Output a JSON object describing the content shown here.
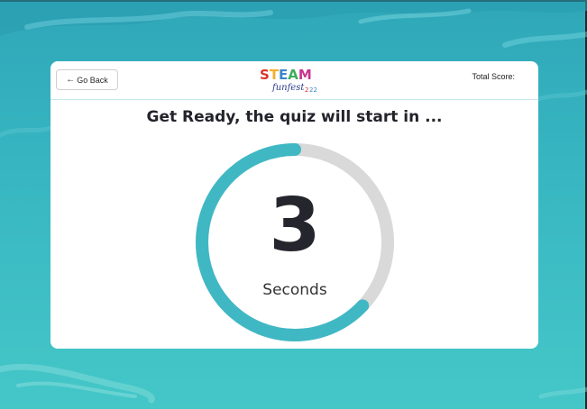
{
  "header": {
    "back_label": "Go Back",
    "back_icon": "arrow-left-icon",
    "logo_text": "STEAM",
    "logo_sub": "funfest",
    "logo_year": "2022",
    "score_label": "Total Score:"
  },
  "main": {
    "heading": "Get Ready, the quiz will start in ...",
    "countdown_value": "3",
    "countdown_unit": "Seconds",
    "progress_fraction": 0.63
  },
  "colors": {
    "accent": "#3fb8c4",
    "track": "#d9d9d9",
    "text_dark": "#23232b"
  }
}
